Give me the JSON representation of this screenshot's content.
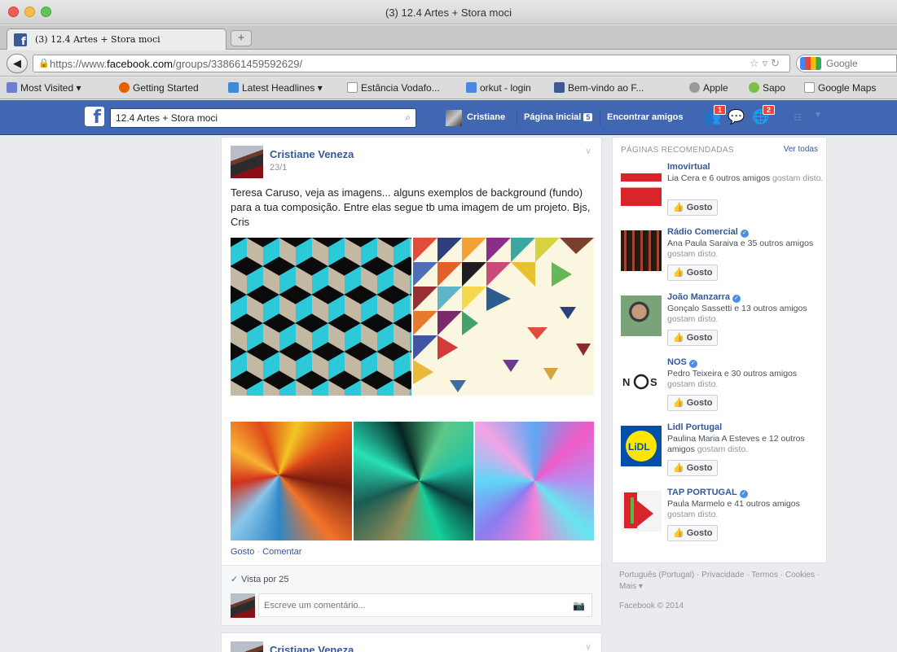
{
  "window": {
    "title": "(3) 12.4 Artes + Stora moci",
    "tab_title": "(3) 12.4 Artes + Stora moci",
    "new_tab_symbol": "+"
  },
  "navbar": {
    "url_prefix": "https://www.",
    "url_domain": "facebook.com",
    "url_path": "/groups/338661459592629/",
    "search_engine": "Google"
  },
  "bookmarks": [
    {
      "label": "Most Visited ▾",
      "color": "#6e7fd1"
    },
    {
      "label": "Getting Started",
      "color": "#e66000"
    },
    {
      "label": "Latest Headlines ▾",
      "color": "#3d8ad8"
    },
    {
      "label": "Estância Vodafo...",
      "color": "#ffffff"
    },
    {
      "label": "orkut - login",
      "color": "#4a86e8"
    },
    {
      "label": "Bem-vindo ao F...",
      "color": "#3b5998"
    },
    {
      "label": "Apple",
      "color": "#999999"
    },
    {
      "label": "Sapo",
      "color": "#7bc142"
    },
    {
      "label": "Google Maps",
      "color": "#ffffff"
    }
  ],
  "fb": {
    "search_value": "12.4 Artes + Stora moci",
    "user_name": "Cristiane",
    "home_label": "Página inicial",
    "home_count": "5",
    "find_friends": "Encontrar amigos",
    "friend_requests_count": "1",
    "notifications_count": "2",
    "brand_color": "#4267b2"
  },
  "post": {
    "author": "Cristiane Veneza",
    "date": "23/1",
    "text": "Teresa Caruso, veja as imagens... alguns exemplos de background (fundo) para a tua composição. Entre elas segue tb uma imagem de um projeto. Bjs, Cris",
    "like_label": "Gosto",
    "comment_label": "Comentar",
    "seen_by": "Vista por 25",
    "comment_placeholder": "Escreve um comentário..."
  },
  "post2": {
    "author": "Cristiane Veneza"
  },
  "recommended": {
    "title": "PÁGINAS RECOMENDADAS",
    "see_all": "Ver todas",
    "like_label": "Gosto",
    "pages": [
      {
        "name": "Imovirtual",
        "verified": false,
        "friends": "Lia Cera e 6 outros amigos",
        "suffix": "gostam disto."
      },
      {
        "name": "Rádio Comercial",
        "verified": true,
        "friends": "Ana Paula Saraiva e 35 outros amigos",
        "suffix": "gostam disto."
      },
      {
        "name": "João Manzarra",
        "verified": true,
        "friends": "Gonçalo Sassetti e 13 outros amigos",
        "suffix": "gostam disto."
      },
      {
        "name": "NOS",
        "verified": true,
        "friends": "Pedro Teixeira e 30 outros amigos",
        "suffix": "gostam disto."
      },
      {
        "name": "Lidl Portugal",
        "verified": false,
        "friends": "Paulina Maria A Esteves e 12 outros amigos",
        "suffix": "gostam disto."
      },
      {
        "name": "TAP PORTUGAL",
        "verified": true,
        "friends": "Paula Marmelo e 41 outros amigos",
        "suffix": "gostam disto."
      }
    ]
  },
  "footer": {
    "links": [
      "Português (Portugal)",
      "Privacidade",
      "Termos",
      "Cookies",
      "Mais ▾"
    ],
    "copyright": "Facebook © 2014"
  }
}
